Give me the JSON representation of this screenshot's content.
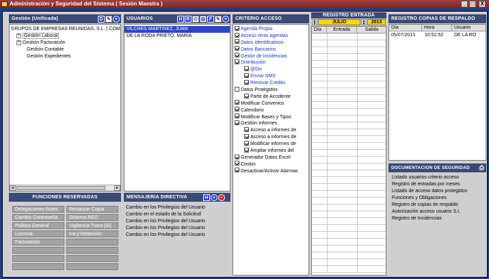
{
  "window": {
    "title": "Administración y Seguridad del Sistema ( Sesión Maestra )",
    "minimize": "_",
    "maximize": "□",
    "close": "X"
  },
  "gestion": {
    "title": "Gestión (Unificada)",
    "root": "GRUPOS DE EMPRESAS REUNIDAS, S.L. ( COM",
    "items": [
      {
        "label": "Gestión Laboral",
        "expandable": true
      },
      {
        "label": "Gestión Facturación",
        "expandable": true
      },
      {
        "label": "Gestión Contable",
        "expandable": false
      },
      {
        "label": "Gestión Expedientes",
        "expandable": false
      }
    ]
  },
  "usuarios": {
    "title": "USUARIOS",
    "buttons": [
      "H",
      "R",
      "@",
      "",
      "F",
      ""
    ],
    "list": [
      "VILCHES MARTINEZ, JUAN",
      "DE LA RODA PRIETO, MARIA"
    ]
  },
  "funciones": {
    "title": "FUNCIONES RESERVADAS",
    "col1": [
      "Delegaciones-Roles",
      "Cambio Contraseña",
      "Politica General",
      "Licencia",
      "Facturación",
      "",
      "",
      ""
    ],
    "col2": [
      "Restaurar Copia",
      "Sistema RED",
      "Vigilancia Traza [SI]",
      "Iva y Retención",
      "",
      "",
      "",
      ""
    ]
  },
  "mensajeria": {
    "title": "MENSAJERIA DIRECTIVA",
    "button_h": "H",
    "messages": [
      "Cambio en los Privilegios del Usuario",
      "Cambio en el estado de la Solicitud",
      "Cambio en los Privilegios del Usuario",
      "Cambio en los Privilegios del Usuario",
      "Cambio en los Privilegios del Usuario"
    ]
  },
  "criterio": {
    "title": "CRITERIO ACCESO",
    "items": [
      {
        "label": "Agenda Propia",
        "level": 0,
        "checked": true,
        "blue": true
      },
      {
        "label": "Acceso otras agendas",
        "level": 0,
        "checked": true,
        "blue": true
      },
      {
        "label": "Datos Identificativos",
        "level": 0,
        "checked": true,
        "blue": true
      },
      {
        "label": "Datos Bancarios",
        "level": 0,
        "checked": true,
        "blue": true
      },
      {
        "label": "Gestor de Incidencias",
        "level": 0,
        "checked": true,
        "blue": true
      },
      {
        "label": "Distribución",
        "level": 0,
        "checked": true,
        "blue": true
      },
      {
        "label": "@Dic",
        "level": 2,
        "checked": true,
        "blue": true
      },
      {
        "label": "Enviar SMS",
        "level": 2,
        "checked": true,
        "blue": true
      },
      {
        "label": "Renovar Crédito",
        "level": 2,
        "checked": true,
        "blue": true
      },
      {
        "label": "Datos Protegidos",
        "level": 0,
        "checked": false,
        "blue": false
      },
      {
        "label": "Parte de Accidente",
        "level": 2,
        "checked": true,
        "blue": false
      },
      {
        "label": "Modificar Convenios",
        "level": 0,
        "checked": true,
        "blue": false
      },
      {
        "label": "Calendario",
        "level": 0,
        "checked": true,
        "blue": false
      },
      {
        "label": "Modificar Bases y Tipos",
        "level": 0,
        "checked": true,
        "blue": false
      },
      {
        "label": "Gestión Informes",
        "level": 0,
        "checked": true,
        "blue": false
      },
      {
        "label": "Acceso a informes de",
        "level": 2,
        "checked": true,
        "blue": false
      },
      {
        "label": "Acceso a informes de",
        "level": 2,
        "checked": true,
        "blue": false
      },
      {
        "label": "Modificar informes de",
        "level": 2,
        "checked": true,
        "blue": false
      },
      {
        "label": "Ampliar informes del",
        "level": 2,
        "checked": true,
        "blue": false
      },
      {
        "label": "Generador Datos Excel",
        "level": 0,
        "checked": true,
        "blue": false
      },
      {
        "label": "Costos",
        "level": 0,
        "checked": true,
        "blue": false
      },
      {
        "label": "Desactivar/Activar Alarmas",
        "level": 0,
        "checked": true,
        "blue": false
      }
    ]
  },
  "registro": {
    "title": "REGISTRO ENTRADA",
    "month": "JULIO",
    "year": "2013",
    "columns": [
      "Día",
      "Entrada",
      "Salida"
    ]
  },
  "copias": {
    "title": "REGISTRO COPIAS DE RESPALDO",
    "columns": [
      "Día",
      "Hora",
      "Usuario"
    ],
    "rows": [
      [
        "05/07/2013",
        "10:52:52",
        "DE LA RO"
      ]
    ]
  },
  "documentacion": {
    "title": "DOCUMENTACION DE SEGURIDAD",
    "items": [
      "Listado usuarios criterio acceso",
      "Registro de entradas por meses",
      "Listado de acceso datos protegidos",
      "Funciones y Obligaciones",
      "Registro de copias de respaldo",
      "Autorización acceso usuario S.I.",
      "Registro de Incidencias"
    ]
  },
  "colors": {
    "header": "#3b4a75",
    "selection": "#2d46c6",
    "title_bar": "#8a2f2f",
    "month_field": "#ffd700"
  }
}
